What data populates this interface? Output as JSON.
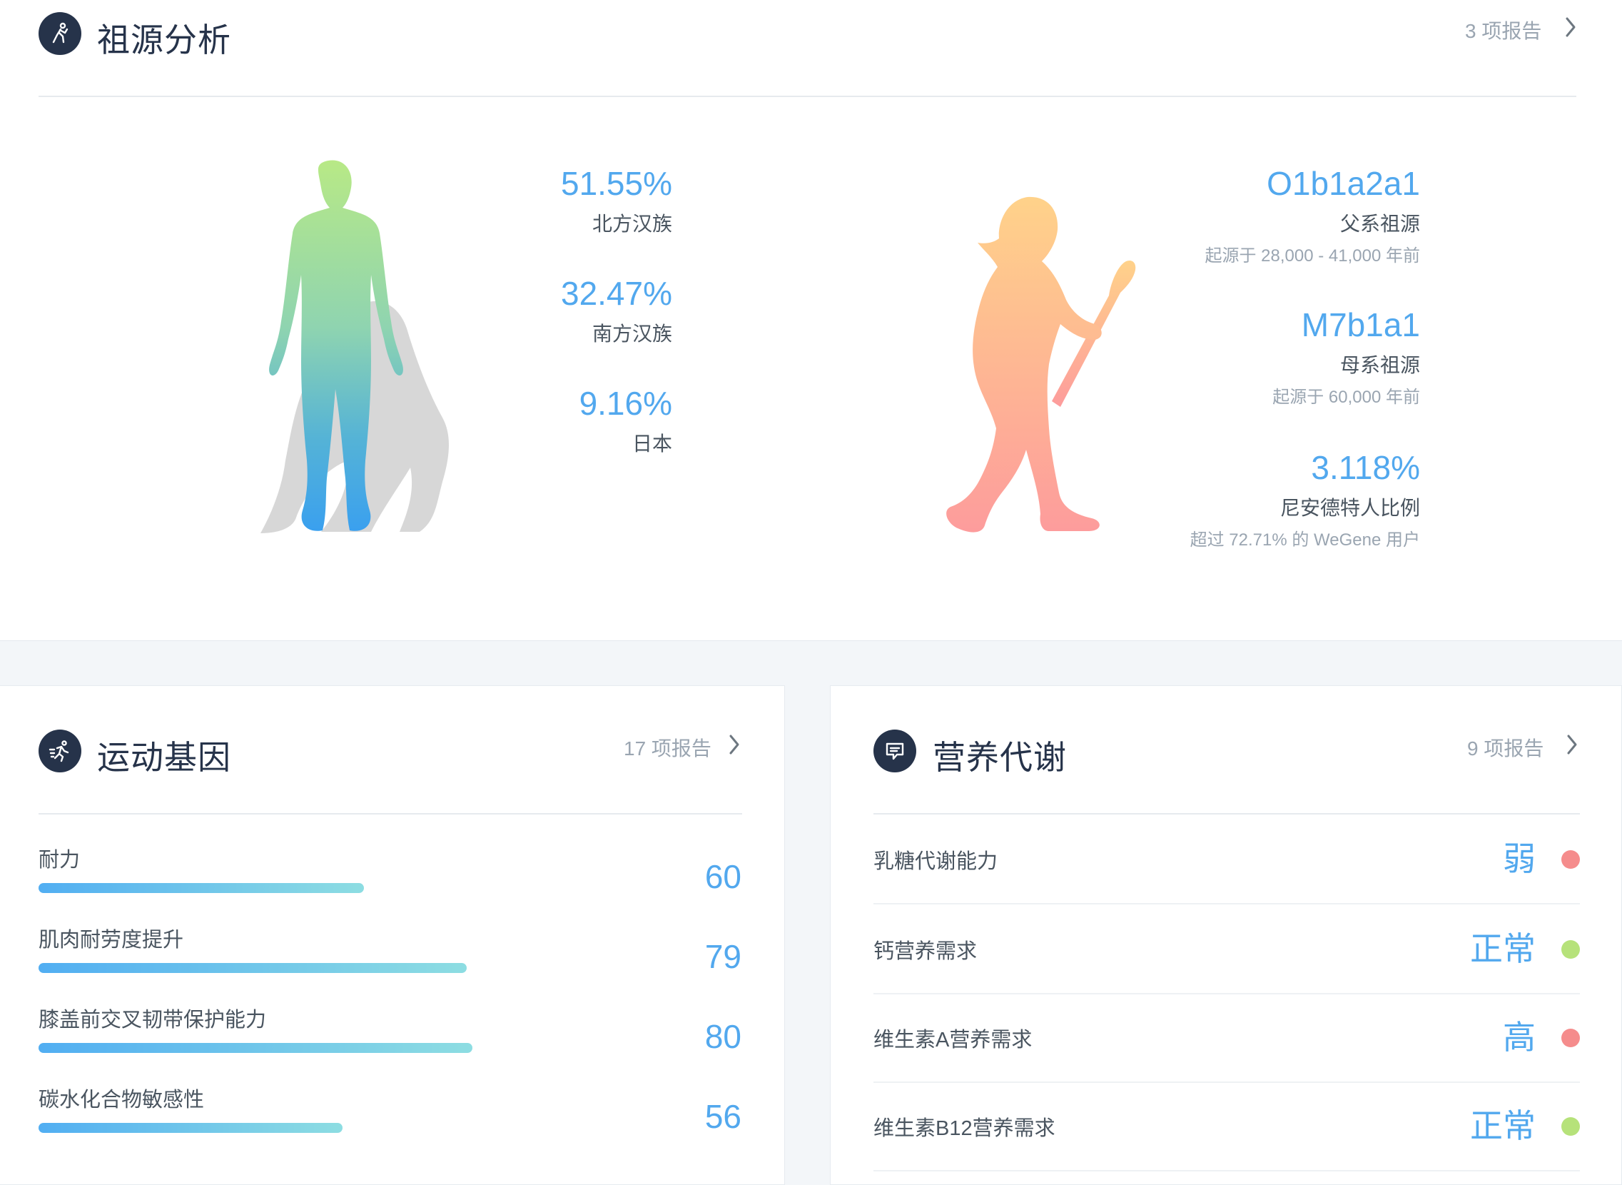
{
  "colors": {
    "accent": "#52a8ee",
    "dot_red": "#f58c8c",
    "dot_green": "#b6e27a",
    "header_icon": "#26334a"
  },
  "ancestry": {
    "icon": "ancestry-figure-icon",
    "title": "祖源分析",
    "reports": "3 项报告",
    "compositions": [
      {
        "value": "51.55%",
        "label": "北方汉族",
        "percent": 51.55
      },
      {
        "value": "32.47%",
        "label": "南方汉族",
        "percent": 32.47
      },
      {
        "value": "9.16%",
        "label": "日本",
        "percent": 9.16
      }
    ],
    "haplogroups": [
      {
        "value": "O1b1a2a1",
        "label": "父系祖源",
        "sub": "起源于 28,000 - 41,000 年前"
      },
      {
        "value": "M7b1a1",
        "label": "母系祖源",
        "sub": "起源于 60,000 年前"
      },
      {
        "value": "3.118%",
        "label": "尼安德特人比例",
        "sub": "超过 72.71% 的 WeGene 用户"
      }
    ]
  },
  "sports": {
    "icon": "runner-icon",
    "title": "运动基因",
    "reports": "17 项报告",
    "traits": [
      {
        "name": "耐力",
        "score": "60",
        "value": 60
      },
      {
        "name": "肌肉耐劳度提升",
        "score": "79",
        "value": 79
      },
      {
        "name": "膝盖前交叉韧带保护能力",
        "score": "80",
        "value": 80
      },
      {
        "name": "碳水化合物敏感性",
        "score": "56",
        "value": 56
      }
    ]
  },
  "nutrition": {
    "icon": "nutrition-chat-icon",
    "title": "营养代谢",
    "reports": "9 项报告",
    "items": [
      {
        "name": "乳糖代谢能力",
        "level": "弱",
        "status": "red"
      },
      {
        "name": "钙营养需求",
        "level": "正常",
        "status": "green"
      },
      {
        "name": "维生素A营养需求",
        "level": "高",
        "status": "red"
      },
      {
        "name": "维生素B12营养需求",
        "level": "正常",
        "status": "green"
      }
    ]
  }
}
